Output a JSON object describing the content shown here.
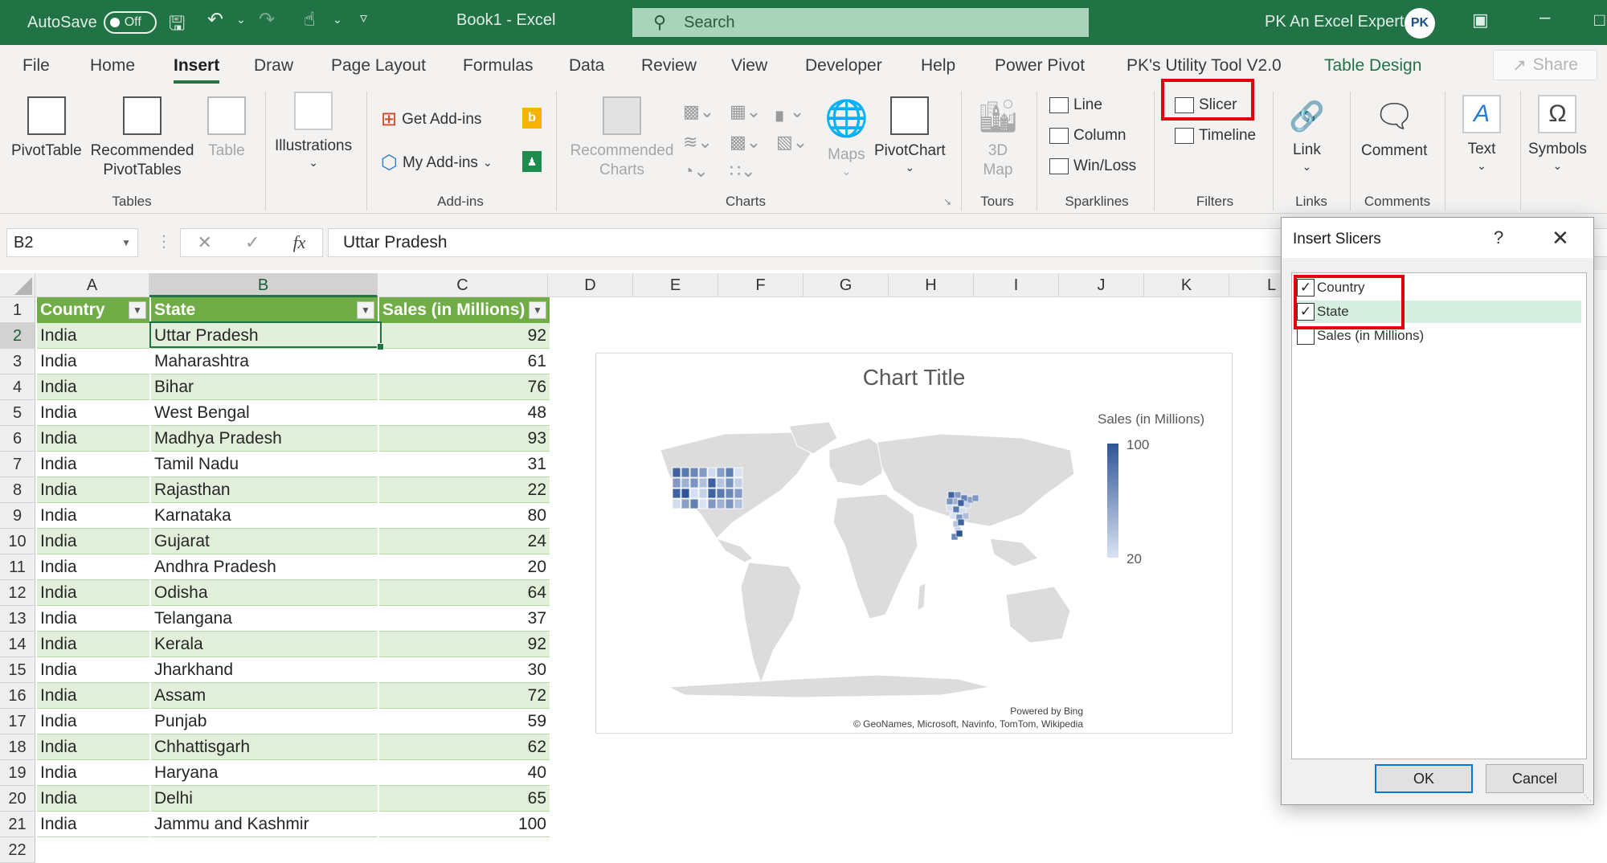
{
  "titlebar": {
    "autosave_label": "AutoSave",
    "autosave_state": "Off",
    "doc_title": "Book1  -  Excel",
    "search_placeholder": "Search",
    "user_name": "PK An Excel Expert",
    "avatar_initials": "PK"
  },
  "menu": {
    "tabs": [
      "File",
      "Home",
      "Insert",
      "Draw",
      "Page Layout",
      "Formulas",
      "Data",
      "Review",
      "View",
      "Developer",
      "Help",
      "Power Pivot",
      "PK's Utility Tool V2.0",
      "Table Design"
    ],
    "active_tab": "Insert",
    "share_label": "Share"
  },
  "ribbon": {
    "tables": {
      "label": "Tables",
      "pivottable": "PivotTable",
      "recommended_pivottables": "Recommended PivotTables",
      "table": "Table"
    },
    "illustrations": {
      "label": "Illustrations"
    },
    "addins": {
      "label": "Add-ins",
      "get_addins": "Get Add-ins",
      "my_addins": "My Add-ins"
    },
    "charts": {
      "label": "Charts",
      "recommended_charts": "Recommended Charts",
      "maps": "Maps",
      "pivotchart": "PivotChart"
    },
    "tours": {
      "label": "Tours",
      "map3d": "3D Map"
    },
    "sparklines": {
      "label": "Sparklines",
      "line": "Line",
      "column": "Column",
      "winloss": "Win/Loss"
    },
    "filters": {
      "label": "Filters",
      "slicer": "Slicer",
      "timeline": "Timeline"
    },
    "links": {
      "label": "Links",
      "link": "Link"
    },
    "comments": {
      "label": "Comments",
      "comment": "Comment"
    },
    "text": {
      "label": "Text"
    },
    "symbols": {
      "label": "Symbols"
    }
  },
  "formula_bar": {
    "name_box": "B2",
    "formula": "Uttar Pradesh"
  },
  "sheet": {
    "columns": [
      "A",
      "B",
      "C",
      "D",
      "E",
      "F",
      "G",
      "H",
      "I",
      "J",
      "K",
      "L"
    ],
    "selected_column": "B",
    "selected_cell": "B2",
    "headers": [
      "Country",
      "State",
      "Sales (in Millions)"
    ],
    "rows": [
      {
        "row": "2",
        "country": "India",
        "state": "Uttar Pradesh",
        "sales": "92"
      },
      {
        "row": "3",
        "country": "India",
        "state": "Maharashtra",
        "sales": "61"
      },
      {
        "row": "4",
        "country": "India",
        "state": "Bihar",
        "sales": "76"
      },
      {
        "row": "5",
        "country": "India",
        "state": "West Bengal",
        "sales": "48"
      },
      {
        "row": "6",
        "country": "India",
        "state": "Madhya Pradesh",
        "sales": "93"
      },
      {
        "row": "7",
        "country": "India",
        "state": "Tamil Nadu",
        "sales": "31"
      },
      {
        "row": "8",
        "country": "India",
        "state": "Rajasthan",
        "sales": "22"
      },
      {
        "row": "9",
        "country": "India",
        "state": "Karnataka",
        "sales": "80"
      },
      {
        "row": "10",
        "country": "India",
        "state": "Gujarat",
        "sales": "24"
      },
      {
        "row": "11",
        "country": "India",
        "state": "Andhra Pradesh",
        "sales": "20"
      },
      {
        "row": "12",
        "country": "India",
        "state": "Odisha",
        "sales": "64"
      },
      {
        "row": "13",
        "country": "India",
        "state": "Telangana",
        "sales": "37"
      },
      {
        "row": "14",
        "country": "India",
        "state": "Kerala",
        "sales": "92"
      },
      {
        "row": "15",
        "country": "India",
        "state": "Jharkhand",
        "sales": "30"
      },
      {
        "row": "16",
        "country": "India",
        "state": "Assam",
        "sales": "72"
      },
      {
        "row": "17",
        "country": "India",
        "state": "Punjab",
        "sales": "59"
      },
      {
        "row": "18",
        "country": "India",
        "state": "Chhattisgarh",
        "sales": "62"
      },
      {
        "row": "19",
        "country": "India",
        "state": "Haryana",
        "sales": "40"
      },
      {
        "row": "20",
        "country": "India",
        "state": "Delhi",
        "sales": "65"
      },
      {
        "row": "21",
        "country": "India",
        "state": "Jammu and Kashmir",
        "sales": "100"
      }
    ]
  },
  "chart": {
    "title": "Chart Title",
    "legend_title": "Sales (in Millions)",
    "legend_max": "100",
    "legend_min": "20",
    "credit_line1": "Powered by Bing",
    "credit_line2": "© GeoNames, Microsoft, Navinfo, TomTom, Wikipedia",
    "colors": {
      "low": "#dae3f3",
      "high": "#2f5597",
      "land": "#dcdcdc"
    }
  },
  "dialog": {
    "title": "Insert Slicers",
    "help": "?",
    "items": [
      {
        "label": "Country",
        "checked": true
      },
      {
        "label": "State",
        "checked": true
      },
      {
        "label": "Sales (in Millions)",
        "checked": false
      }
    ],
    "ok_label": "OK",
    "cancel_label": "Cancel"
  },
  "colors": {
    "excel_green": "#217346",
    "table_header": "#70ad47",
    "table_band": "#e2efda",
    "highlight_red": "#e3000f"
  }
}
